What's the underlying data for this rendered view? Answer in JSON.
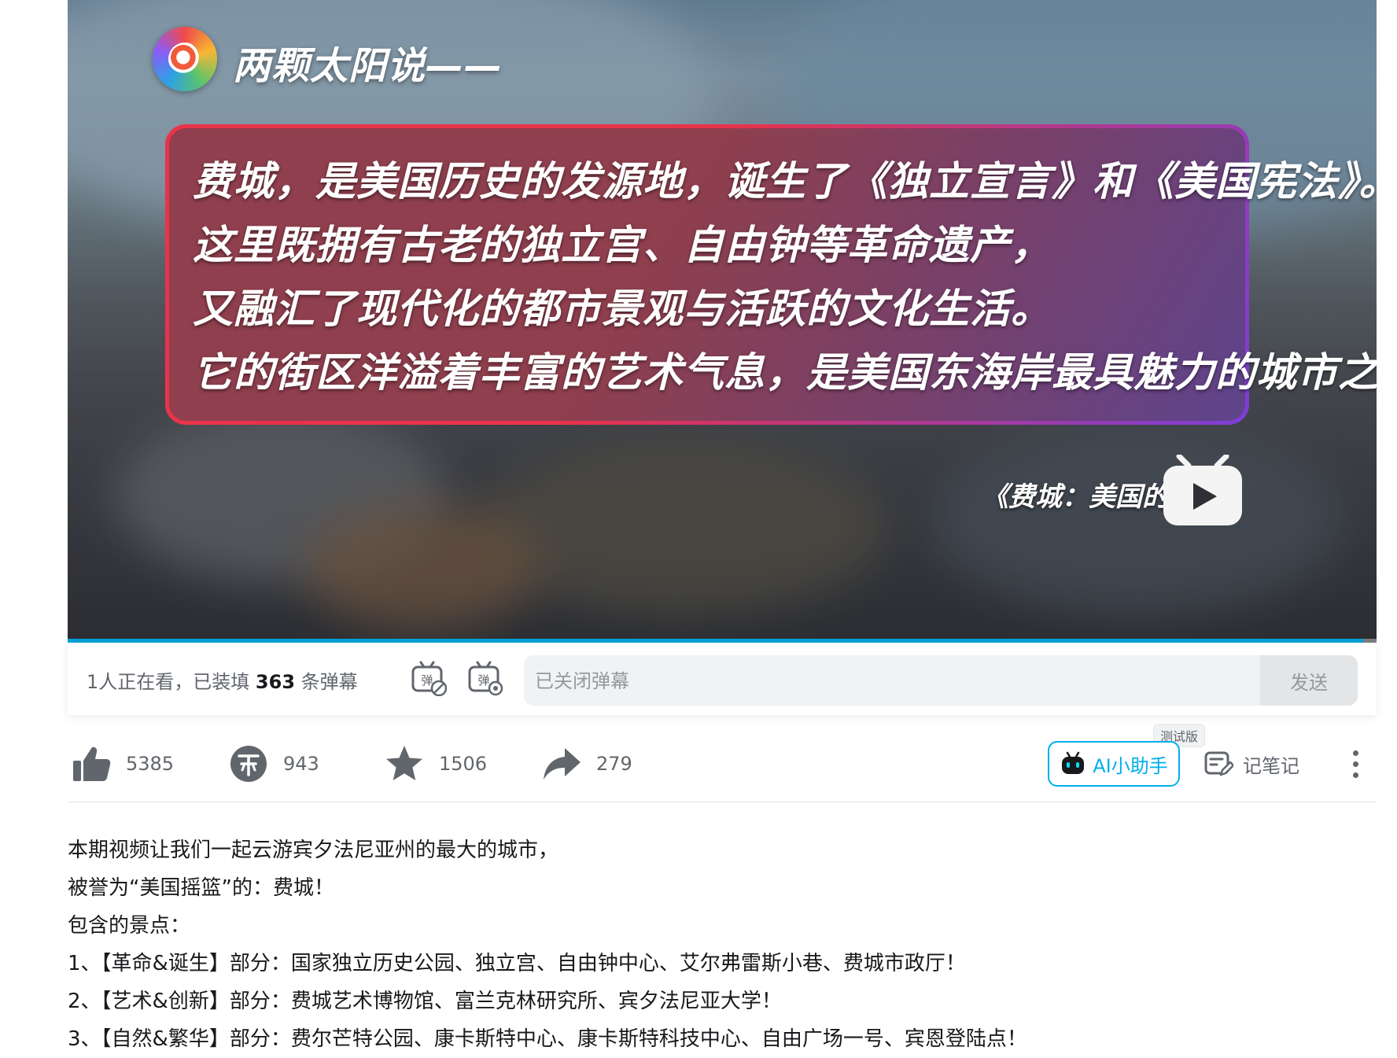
{
  "video": {
    "channel_name": "两颗太阳说——",
    "quote_lines": [
      "费城，是美国历史的发源地，诞生了《独立宣言》和《美国宪法》。",
      "这里既拥有古老的独立宫、自由钟等革命遗产，",
      "又融汇了现代化的都市景观与活跃的文化生活。",
      "它的街区洋溢着丰富的艺术气息，是美国东海岸最具魅力的城市之一。"
    ],
    "subtitle": "《费城：美国的摇篮》",
    "progress_fraction": 0.99,
    "colors": {
      "frame_start": "#e8334a",
      "frame_end": "#7c3ed6",
      "progress": "#00a1d6"
    },
    "icons": {
      "logo": "channel-logo",
      "tv": "bilibili-tv-play-icon"
    }
  },
  "danmaku": {
    "viewers_text": "1人正在看，已装填",
    "count": "363",
    "count_suffix": "条弹幕",
    "placeholder": "已关闭弹幕",
    "send_label": "发送",
    "icons": {
      "toggle": "danmaku-off-icon",
      "setting": "danmaku-setting-icon"
    }
  },
  "actions": {
    "like": {
      "icon": "thumbs-up-icon",
      "count": "5385"
    },
    "coin": {
      "icon": "coin-icon",
      "count": "943"
    },
    "favorite": {
      "icon": "star-icon",
      "count": "1506"
    },
    "share": {
      "icon": "share-arrow-icon",
      "count": "279"
    },
    "ai_badge": "测试版",
    "ai_label": "AI小助手",
    "note_label": "记笔记",
    "colors": {
      "accent": "#00aeec",
      "icon": "#61666d"
    }
  },
  "description": {
    "lines": [
      "本期视频让我们一起云游宾夕法尼亚州的最大的城市，",
      "被誉为“美国摇篮”的：费城！",
      "包含的景点：",
      "1、【革命&诞生】部分：国家独立历史公园、独立宫、自由钟中心、艾尔弗雷斯小巷、费城市政厅！",
      "2、【艺术&创新】部分：费城艺术博物馆、富兰克林研究所、宾夕法尼亚大学！",
      "3、【自然&繁华】部分：费尔芒特公园、康卡斯特中心、康卡斯特科技中心、自由广场一号、宾恩登陆点！"
    ]
  }
}
